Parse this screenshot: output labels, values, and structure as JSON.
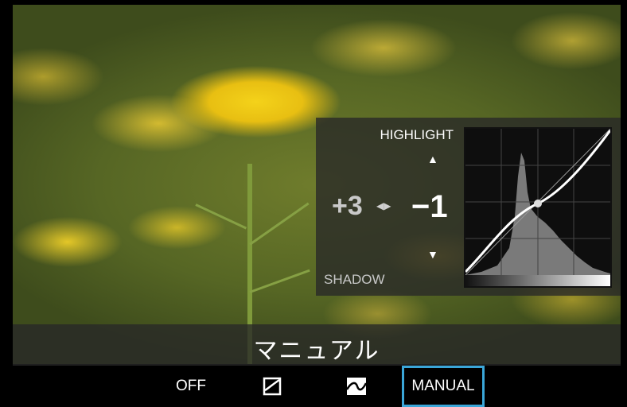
{
  "tone": {
    "highlight_label": "HIGHLIGHT",
    "shadow_label": "SHADOW",
    "shadow_value": "+3",
    "highlight_value": "−1",
    "adjust_icon": "left-right-arrows-icon",
    "up_icon": "triangle-up-icon",
    "down_icon": "triangle-down-icon"
  },
  "mode": {
    "caption": "マニュアル"
  },
  "options": {
    "off_label": "OFF",
    "icon1": "square-curve-icon",
    "icon2": "wave-curve-icon",
    "manual_label": "MANUAL",
    "selected": "MANUAL",
    "selection_color": "#3aa6d8"
  }
}
